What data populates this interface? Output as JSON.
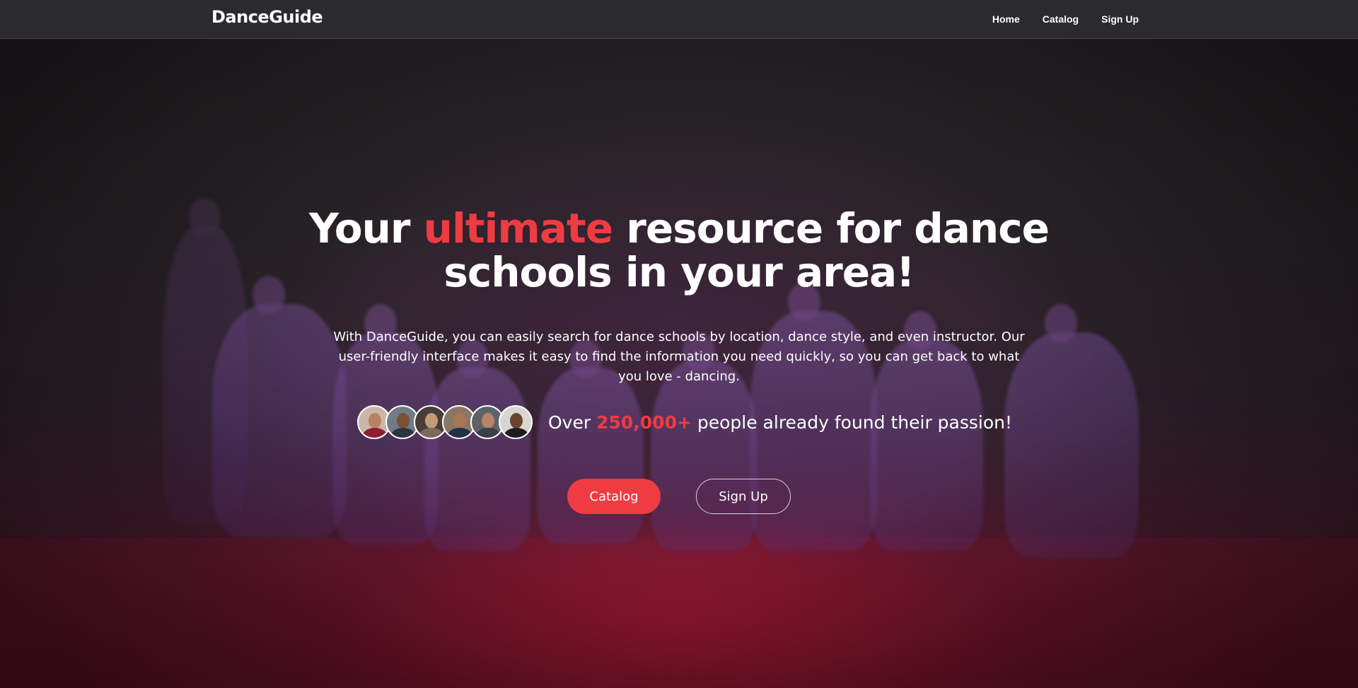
{
  "nav": {
    "brand": "DanceGuide",
    "links": [
      {
        "label": "Home"
      },
      {
        "label": "Catalog"
      },
      {
        "label": "Sign Up"
      }
    ]
  },
  "hero": {
    "headline_part1": "Your ",
    "headline_accent": "ultimate",
    "headline_part2": " resource for dance schools in your area!",
    "description": "With DanceGuide, you can easily search for dance schools by location, dance style, and even instructor. Our user-friendly interface makes it easy to find the information you need quickly, so you can get back to what you love - dancing.",
    "proof_prefix": "Over ",
    "proof_count": "250,000+",
    "proof_suffix": " people already found their passion!",
    "cta_primary": "Catalog",
    "cta_secondary": "Sign Up"
  },
  "colors": {
    "accent": "#ef3b42",
    "nav_bg": "#2b2a2c"
  }
}
